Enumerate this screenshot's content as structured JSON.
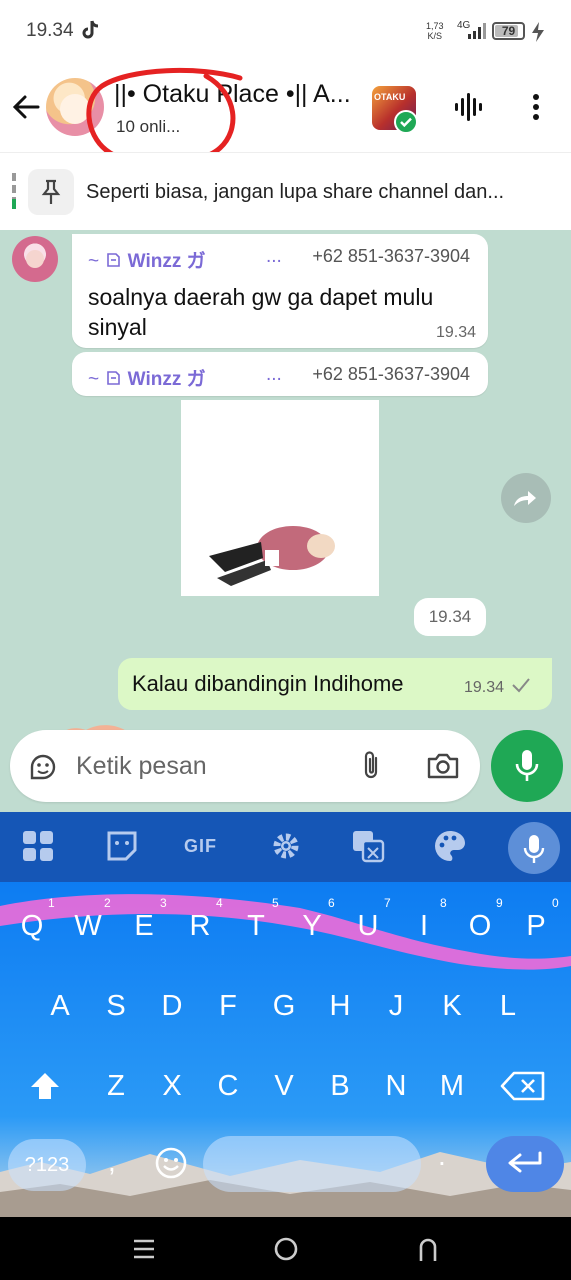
{
  "status_bar": {
    "time": "19.34",
    "net_speed_value": "1,73",
    "net_speed_unit": "K/S",
    "network": "4G",
    "battery": "79"
  },
  "header": {
    "title": "||• Otaku Place •|| A...",
    "subtitle": "10 onli...",
    "channel_icon_text": "OTAKU"
  },
  "pinned": {
    "text": "Seperti biasa, jangan lupa share channel dan..."
  },
  "messages": [
    {
      "sender_prefix": "~",
      "sender_name": "Winzz ガ",
      "sender_dots": "...",
      "sender_phone": "+62 851-3637-3904",
      "text": "soalnya daerah gw ga dapet mulu sinyal",
      "time": "19.34"
    },
    {
      "sender_prefix": "~",
      "sender_name": "Winzz ガ",
      "sender_dots": "...",
      "sender_phone": "+62 851-3637-3904",
      "sticker_time": "19.34"
    },
    {
      "outgoing_text": "Kalau dibandingin Indihome",
      "time": "19.34"
    }
  ],
  "input": {
    "placeholder": "Ketik pesan"
  },
  "keyboard": {
    "gif_label": "GIF",
    "row1": [
      "Q",
      "W",
      "E",
      "R",
      "T",
      "Y",
      "U",
      "I",
      "O",
      "P"
    ],
    "row1_hints": [
      "1",
      "2",
      "3",
      "4",
      "5",
      "6",
      "7",
      "8",
      "9",
      "0"
    ],
    "row2": [
      "A",
      "S",
      "D",
      "F",
      "G",
      "H",
      "J",
      "K",
      "L"
    ],
    "row3": [
      "Z",
      "X",
      "C",
      "V",
      "B",
      "N",
      "M"
    ],
    "num_key": "?123",
    "comma": ",",
    "period": "."
  },
  "colors": {
    "chat_bg": "#c0dcd0",
    "outgoing_bubble": "#dcf8c6",
    "accent_green": "#1fa855",
    "sender_name": "#7b6ad6",
    "keyboard_toolbar": "#1556b6"
  }
}
